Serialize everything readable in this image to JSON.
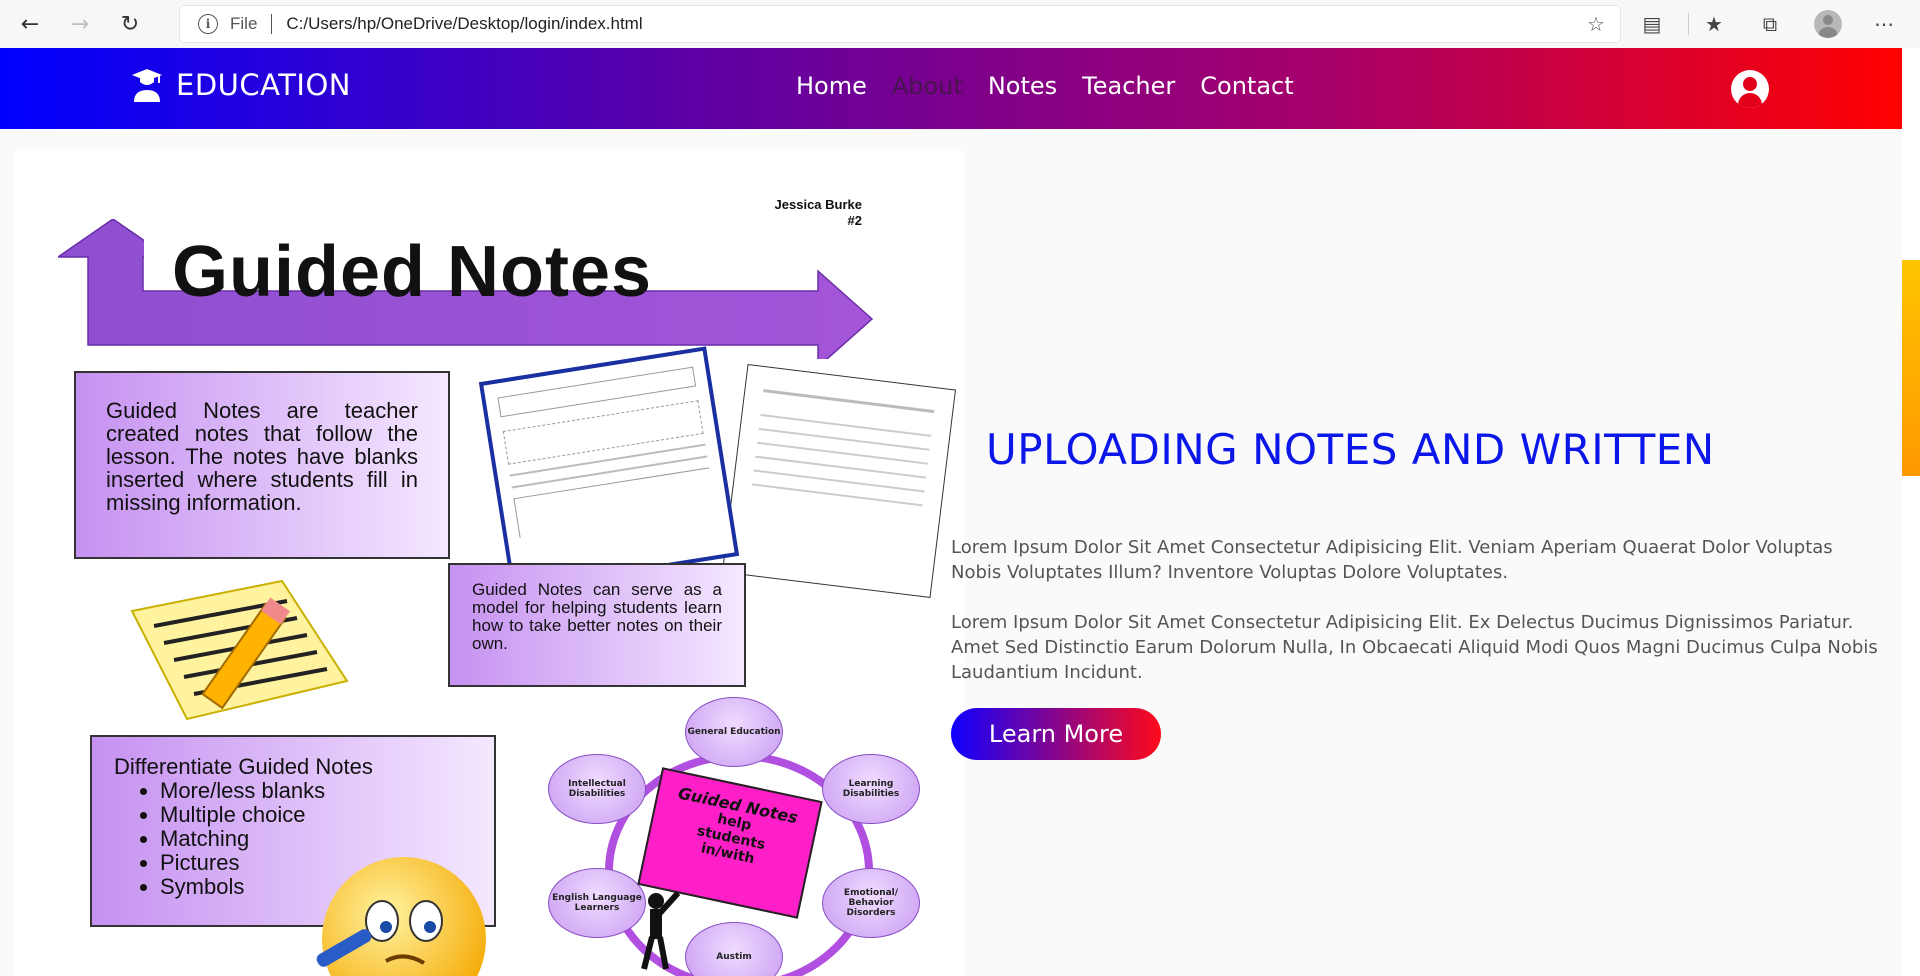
{
  "browser": {
    "scheme_label": "File",
    "url": "C:/Users/hp/OneDrive/Desktop/login/index.html"
  },
  "navbar": {
    "brand": "EDUCATION",
    "links": [
      "Home",
      "About",
      "Notes",
      "Teacher",
      "Contact"
    ],
    "active_link": "About"
  },
  "colors": {
    "gradient_start": "#0000ff",
    "gradient_end": "#ff0000",
    "heading": "#0b16e8",
    "scroll_thumb": "#ffc400"
  },
  "main": {
    "heading": "UPLOADING NOTES AND WRITTEN",
    "paragraph_1": "Lorem Ipsum Dolor Sit Amet Consectetur Adipisicing Elit. Veniam Aperiam Quaerat Dolor Voluptas Nobis Voluptates Illum? Inventore Voluptas Dolore Voluptates.",
    "paragraph_2": "Lorem Ipsum Dolor Sit Amet Consectetur Adipisicing Elit. Ex Delectus Ducimus Dignissimos Pariatur. Amet Sed Distinctio Earum Dolorum Nulla, In Obcaecati Aliquid Modi Quos Magni Ducimus Culpa Nobis Laudantium Incidunt.",
    "cta_label": "Learn More"
  },
  "poster": {
    "author": "Jessica Burke",
    "author_num": "#2",
    "title": "Guided Notes",
    "box1": "Guided Notes are teacher created notes that follow the lesson. The notes have blanks inserted where students fill in missing information.",
    "box2": "Guided Notes can serve as a model for helping students learn how to take better notes on their own.",
    "box3_title": "Differentiate Guided Notes",
    "box3_items": [
      "More/less blanks",
      "Multiple choice",
      "Matching",
      "Pictures",
      "Symbols"
    ],
    "center_sign": [
      "Guided Notes",
      "help",
      "students",
      "in/with"
    ],
    "bubbles": [
      "General Education",
      "Learning Disabilities",
      "Emotional/ Behavior Disorders",
      "Austim",
      "English Language Learners",
      "Intellectual Disabilities"
    ]
  }
}
